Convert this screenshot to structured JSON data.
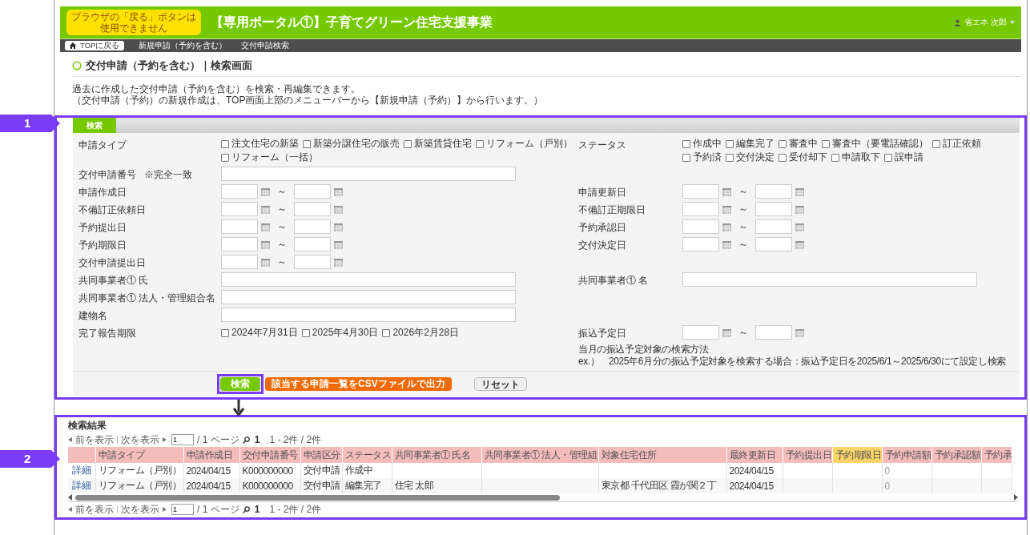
{
  "header": {
    "notice": [
      "ブラウザの「戻る」ボタンは",
      "使用できません"
    ],
    "title": "【専用ポータル①】子育てグリーン住宅支援事業",
    "user": "省エネ 次郎"
  },
  "nav": [
    {
      "kind": "home",
      "label": "TOPに戻る"
    },
    {
      "kind": "link",
      "label": "新規申請（予約を含む）"
    },
    {
      "kind": "link",
      "label": "交付申請検索"
    }
  ],
  "page_title": "交付申請（予約を含む）｜検索画面",
  "description": [
    "過去に作成した交付申請（予約を含む）を検索・再編集できます。",
    "（交付申請（予約）の新規作成は、TOP画面上部のメニューバーから【新規申請（予約）】から行います。）"
  ],
  "callouts": [
    {
      "label": "1"
    },
    {
      "label": "2"
    }
  ],
  "search_panel": {
    "tab": "検索",
    "rows": [
      {
        "left": {
          "label": "申請タイプ",
          "kind": "checks",
          "options": [
            {
              "label": "注文住宅の新築",
              "checked": false
            },
            {
              "label": "新築分譲住宅の販売",
              "checked": false
            },
            {
              "label": "新築賃貸住宅",
              "checked": false
            },
            {
              "label": "リフォーム（戸別）",
              "checked": false
            },
            {
              "label": "リフォーム（一括）",
              "checked": false
            }
          ]
        },
        "right": {
          "label": "ステータス",
          "kind": "checks",
          "options": [
            {
              "label": "作成中",
              "checked": false
            },
            {
              "label": "編集完了",
              "checked": false
            },
            {
              "label": "審査中",
              "checked": false
            },
            {
              "label": "審査中（要電話確認）",
              "checked": false
            },
            {
              "label": "訂正依頼",
              "checked": false
            },
            {
              "label": "予約済",
              "checked": false
            },
            {
              "label": "交付決定",
              "checked": false
            },
            {
              "label": "受付却下",
              "checked": false
            },
            {
              "label": "申請取下",
              "checked": false
            },
            {
              "label": "誤申請",
              "checked": false
            }
          ]
        }
      },
      {
        "left": {
          "label": "交付申請番号",
          "note": "※完全一致",
          "kind": "text"
        }
      },
      {
        "left": {
          "label": "申請作成日",
          "kind": "date_range",
          "separator": "～"
        },
        "right": {
          "label": "申請更新日",
          "kind": "date_range",
          "separator": "～"
        }
      },
      {
        "left": {
          "label": "不備訂正依頼日",
          "kind": "date_range",
          "separator": "～"
        },
        "right": {
          "label": "不備訂正期限日",
          "kind": "date_range",
          "separator": "～"
        }
      },
      {
        "left": {
          "label": "予約提出日",
          "kind": "date_range",
          "separator": "～"
        },
        "right": {
          "label": "予約承認日",
          "kind": "date_range",
          "separator": "～"
        }
      },
      {
        "left": {
          "label": "予約期限日",
          "kind": "date_range",
          "separator": "～"
        },
        "right": {
          "label": "交付決定日",
          "kind": "date_range",
          "separator": "～"
        }
      },
      {
        "left": {
          "label": "交付申請提出日",
          "kind": "date_range",
          "separator": "～"
        }
      },
      {
        "left": {
          "label": "共同事業者① 氏",
          "kind": "text"
        },
        "right": {
          "label": "共同事業者① 名",
          "kind": "text"
        }
      },
      {
        "left": {
          "label": "共同事業者① 法人・管理組合名",
          "kind": "text"
        }
      },
      {
        "left": {
          "label": "建物名",
          "kind": "text"
        }
      },
      {
        "left": {
          "label": "完了報告期限",
          "kind": "checks",
          "options": [
            {
              "label": "2024年7月31日",
              "checked": false
            },
            {
              "label": "2025年4月30日",
              "checked": false
            },
            {
              "label": "2026年2月28日",
              "checked": false
            }
          ]
        },
        "right": {
          "label": "振込予定日",
          "kind": "date_range",
          "separator": "～",
          "hints": [
            "当月の振込予定対象の検索方法",
            "ex.）　2025年6月分の振込予定対象を検索する場合：振込予定日を2025/6/1～2025/6/30にて設定し検索"
          ]
        }
      }
    ],
    "buttons": [
      {
        "label": "検索",
        "kind": "primary",
        "highlighted": true
      },
      {
        "label": "該当する申請一覧をCSVファイルで出力",
        "kind": "export",
        "highlighted": false
      },
      {
        "label": "リセット",
        "kind": "plain",
        "highlighted": false
      }
    ]
  },
  "results": {
    "title": "検索結果",
    "pagers": [
      {
        "prev": "前を表示",
        "next": "次を表示",
        "page": "1",
        "pages": "/ 1 ページ",
        "current": "1",
        "range": "1 - 2件 / 2件"
      },
      {
        "prev": "前を表示",
        "next": "次を表示",
        "page": "1",
        "pages": "/ 1 ページ",
        "current": "1",
        "range": "1 - 2件 / 2件"
      }
    ],
    "columns": [
      {
        "highlighted": false
      },
      {
        "label": "申請タイプ",
        "highlighted": false
      },
      {
        "label": "申請作成日",
        "highlighted": false
      },
      {
        "label": "交付申請番号",
        "highlighted": false
      },
      {
        "label": "申請区分",
        "highlighted": false
      },
      {
        "label": "ステータス",
        "highlighted": false
      },
      {
        "label": "共同事業者① 氏名",
        "highlighted": false
      },
      {
        "label": "共同事業者① 法人・管理組",
        "highlighted": false
      },
      {
        "label": "対象住宅住所",
        "highlighted": false
      },
      {
        "label": "最終更新日",
        "highlighted": false
      },
      {
        "label": "予約提出日",
        "highlighted": false
      },
      {
        "label": "予約期限日",
        "highlighted": true
      },
      {
        "label": "予約申請額",
        "highlighted": false
      },
      {
        "label": "予約承認額",
        "highlighted": false
      },
      {
        "label": "予約承",
        "highlighted": false
      }
    ],
    "rows": [
      [
        "詳細",
        "リフォーム（戸別）",
        "2024/04/15",
        "K000000000",
        "交付申請",
        "作成中",
        null,
        null,
        null,
        "2024/04/15",
        null,
        null,
        "0",
        null,
        null
      ],
      [
        "詳細",
        "リフォーム（戸別）",
        "2024/04/15",
        "K000000000",
        "交付申請",
        "編集完了",
        "住宅 太郎",
        null,
        "東京都 千代田区 霞が関２丁",
        "2024/04/15",
        null,
        null,
        "0",
        null,
        null
      ]
    ]
  }
}
